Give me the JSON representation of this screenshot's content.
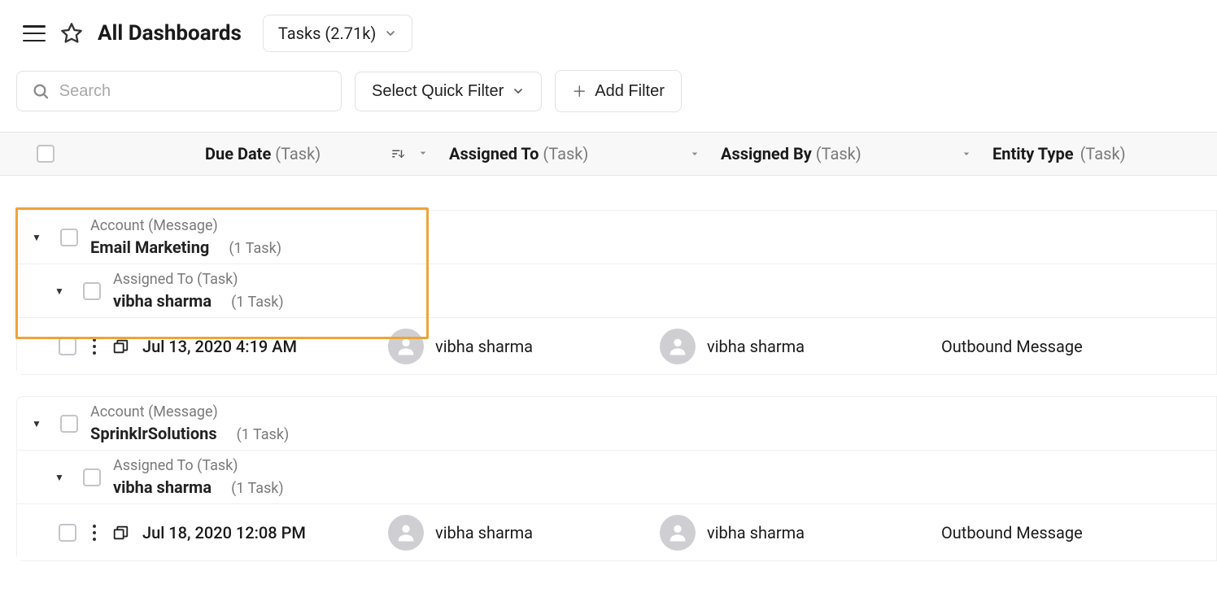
{
  "header": {
    "title": "All Dashboards",
    "tasks_label": "Tasks (2.71k)"
  },
  "filters": {
    "search_placeholder": "Search",
    "quick_filter_label": "Select Quick Filter",
    "add_filter_label": "Add Filter"
  },
  "columns": {
    "due_date": {
      "label": "Due Date",
      "sub": "(Task)"
    },
    "assigned_to": {
      "label": "Assigned To",
      "sub": "(Task)"
    },
    "assigned_by": {
      "label": "Assigned By",
      "sub": "(Task)"
    },
    "entity_type": {
      "label": "Entity Type",
      "sub": "(Task)"
    }
  },
  "groups": [
    {
      "account_sub": "Account (Message)",
      "account_name": "Email Marketing",
      "account_count": "(1 Task)",
      "assignee_sub": "Assigned To (Task)",
      "assignee_name": "vibha sharma",
      "assignee_count": "(1 Task)",
      "tasks": [
        {
          "due": "Jul 13, 2020 4:19 AM",
          "assigned_to": "vibha sharma",
          "assigned_by": "vibha sharma",
          "entity": "Outbound Message"
        }
      ]
    },
    {
      "account_sub": "Account (Message)",
      "account_name": "SprinklrSolutions",
      "account_count": "(1 Task)",
      "assignee_sub": "Assigned To (Task)",
      "assignee_name": "vibha sharma",
      "assignee_count": "(1 Task)",
      "tasks": [
        {
          "due": "Jul 18, 2020 12:08 PM",
          "assigned_to": "vibha sharma",
          "assigned_by": "vibha sharma",
          "entity": "Outbound Message"
        }
      ]
    }
  ]
}
